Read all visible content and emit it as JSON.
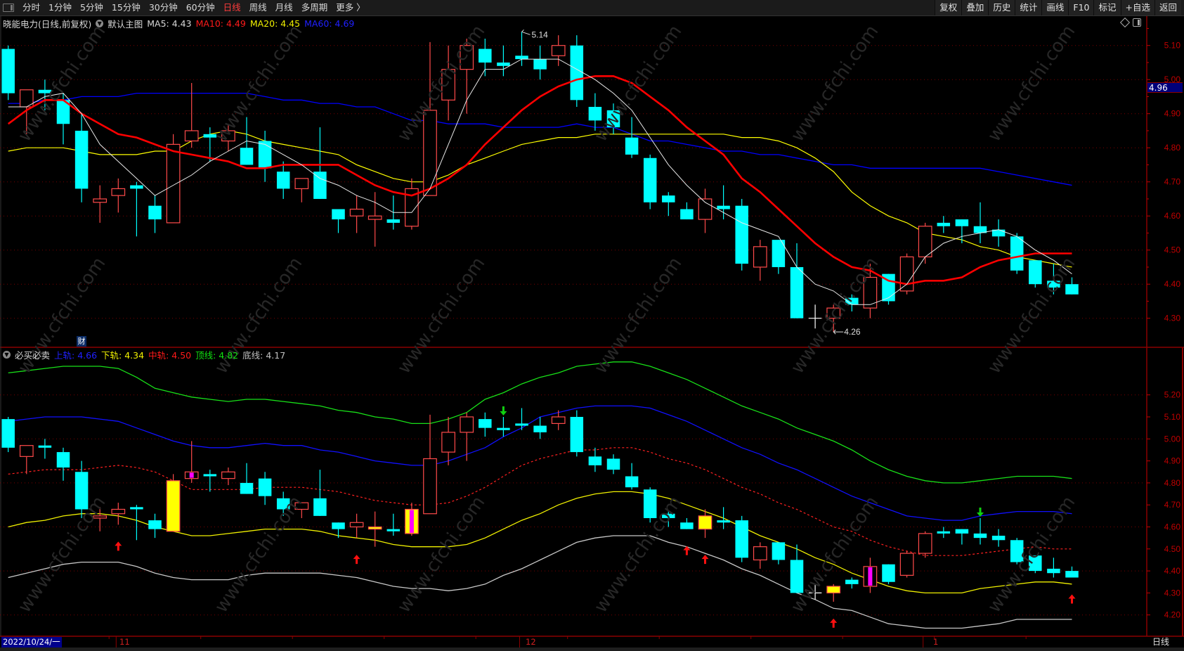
{
  "toolbar": {
    "periods": [
      "分时",
      "1分钟",
      "5分钟",
      "15分钟",
      "30分钟",
      "60分钟",
      "日线",
      "周线",
      "月线",
      "多周期",
      "更多 〉"
    ],
    "active_period": "日线",
    "buttons": [
      "复权",
      "叠加",
      "历史",
      "统计",
      "画线",
      "F10",
      "标记",
      "+自选",
      "返回"
    ]
  },
  "main_legend": {
    "stock": "晓能电力(日线,前复权)",
    "template": "默认主图",
    "ma5": "MA5: 4.43",
    "ma10": "MA10: 4.49",
    "ma20": "MA20: 4.45",
    "ma60": "MA60: 4.69"
  },
  "sub_legend": {
    "name": "必买必卖",
    "upper": "上轨: 4.66",
    "lower": "下轨: 4.34",
    "middle": "中轨: 4.50",
    "top": "顶线: 4.82",
    "bottom": "底线: 4.17"
  },
  "current_price": "4.96",
  "finance_marker": "财",
  "annotations": {
    "high": "5.14",
    "low": "4.26"
  },
  "time_axis": {
    "cursor_date": "2022/10/24/一",
    "months": [
      "11",
      "12",
      "1"
    ],
    "period_label": "日线"
  },
  "watermark": "www.cfchi.com",
  "colors": {
    "up": "#ff4a4a",
    "down": "#00ffff",
    "ma5": "#e8e8e8",
    "ma10": "#ff0000",
    "ma20": "#ffff00",
    "ma60": "#0000ff",
    "grid": "#7a0000",
    "axis": "#c00000"
  },
  "chart_data": {
    "type": "candlestick",
    "ohlc": [
      [
        5.09,
        5.1,
        4.94,
        4.96
      ],
      [
        4.92,
        4.97,
        4.84,
        4.97
      ],
      [
        4.97,
        5.0,
        4.91,
        4.96
      ],
      [
        4.94,
        4.96,
        4.81,
        4.87
      ],
      [
        4.85,
        4.9,
        4.64,
        4.68
      ],
      [
        4.64,
        4.69,
        4.58,
        4.65
      ],
      [
        4.66,
        4.71,
        4.61,
        4.68
      ],
      [
        4.69,
        4.7,
        4.54,
        4.68
      ],
      [
        4.63,
        4.66,
        4.55,
        4.59
      ],
      [
        4.58,
        4.84,
        4.58,
        4.81
      ],
      [
        4.82,
        4.99,
        4.8,
        4.85
      ],
      [
        4.84,
        4.86,
        4.76,
        4.83
      ],
      [
        4.82,
        4.87,
        4.79,
        4.85
      ],
      [
        4.8,
        4.89,
        4.75,
        4.75
      ],
      [
        4.82,
        4.85,
        4.7,
        4.74
      ],
      [
        4.73,
        4.76,
        4.65,
        4.68
      ],
      [
        4.68,
        4.71,
        4.64,
        4.71
      ],
      [
        4.73,
        4.86,
        4.65,
        4.65
      ],
      [
        4.62,
        4.62,
        4.55,
        4.59
      ],
      [
        4.6,
        4.66,
        4.55,
        4.62
      ],
      [
        4.59,
        4.67,
        4.51,
        4.6
      ],
      [
        4.59,
        4.66,
        4.56,
        4.58
      ],
      [
        4.57,
        4.71,
        4.56,
        4.68
      ],
      [
        4.66,
        5.11,
        4.66,
        4.91
      ],
      [
        4.94,
        5.1,
        4.88,
        5.03
      ],
      [
        5.03,
        5.12,
        4.9,
        5.1
      ],
      [
        5.09,
        5.12,
        5.01,
        5.05
      ],
      [
        5.05,
        5.1,
        5.01,
        5.04
      ],
      [
        5.07,
        5.14,
        5.04,
        5.06
      ],
      [
        5.06,
        5.1,
        5.0,
        5.03
      ],
      [
        5.07,
        5.13,
        5.04,
        5.1
      ],
      [
        5.1,
        5.13,
        4.92,
        4.94
      ],
      [
        4.92,
        4.96,
        4.85,
        4.88
      ],
      [
        4.91,
        4.93,
        4.84,
        4.86
      ],
      [
        4.83,
        4.89,
        4.77,
        4.78
      ],
      [
        4.77,
        4.78,
        4.62,
        4.64
      ],
      [
        4.66,
        4.67,
        4.6,
        4.64
      ],
      [
        4.62,
        4.64,
        4.59,
        4.59
      ],
      [
        4.59,
        4.68,
        4.55,
        4.65
      ],
      [
        4.63,
        4.69,
        4.59,
        4.62
      ],
      [
        4.63,
        4.65,
        4.44,
        4.46
      ],
      [
        4.45,
        4.53,
        4.41,
        4.51
      ],
      [
        4.53,
        4.53,
        4.43,
        4.45
      ],
      [
        4.45,
        4.52,
        4.3,
        4.3
      ],
      [
        4.3,
        4.34,
        4.27,
        4.3
      ],
      [
        4.3,
        4.34,
        4.26,
        4.33
      ],
      [
        4.36,
        4.37,
        4.32,
        4.34
      ],
      [
        4.33,
        4.46,
        4.3,
        4.42
      ],
      [
        4.43,
        4.43,
        4.34,
        4.35
      ],
      [
        4.38,
        4.49,
        4.37,
        4.48
      ],
      [
        4.48,
        4.58,
        4.46,
        4.57
      ],
      [
        4.58,
        4.6,
        4.55,
        4.57
      ],
      [
        4.59,
        4.59,
        4.52,
        4.57
      ],
      [
        4.57,
        4.64,
        4.52,
        4.55
      ],
      [
        4.56,
        4.59,
        4.51,
        4.54
      ],
      [
        4.54,
        4.55,
        4.43,
        4.44
      ],
      [
        4.47,
        4.47,
        4.39,
        4.4
      ],
      [
        4.41,
        4.46,
        4.37,
        4.39
      ],
      [
        4.4,
        4.42,
        4.37,
        4.37
      ]
    ],
    "ma5": [
      4.92,
      4.92,
      4.95,
      4.96,
      4.9,
      4.81,
      4.76,
      4.71,
      4.66,
      4.69,
      4.72,
      4.76,
      4.79,
      4.82,
      4.81,
      4.78,
      4.75,
      4.71,
      4.69,
      4.66,
      4.64,
      4.61,
      4.61,
      4.68,
      4.81,
      4.94,
      5.03,
      5.03,
      5.06,
      5.06,
      5.06,
      5.03,
      5.0,
      4.96,
      4.91,
      4.83,
      4.75,
      4.69,
      4.64,
      4.61,
      4.58,
      4.56,
      4.54,
      4.45,
      4.4,
      4.38,
      4.34,
      4.34,
      4.36,
      4.4,
      4.48,
      4.52,
      4.54,
      4.55,
      4.56,
      4.54,
      4.5,
      4.47,
      4.43
    ],
    "ma10": [
      4.87,
      4.91,
      4.94,
      4.94,
      4.9,
      4.87,
      4.84,
      4.83,
      4.81,
      4.79,
      4.78,
      4.77,
      4.76,
      4.74,
      4.74,
      4.75,
      4.75,
      4.75,
      4.75,
      4.72,
      4.69,
      4.67,
      4.66,
      4.68,
      4.71,
      4.75,
      4.81,
      4.86,
      4.91,
      4.95,
      4.98,
      5.0,
      5.01,
      5.01,
      4.99,
      4.95,
      4.91,
      4.86,
      4.82,
      4.78,
      4.71,
      4.67,
      4.62,
      4.57,
      4.52,
      4.48,
      4.45,
      4.44,
      4.41,
      4.4,
      4.41,
      4.41,
      4.42,
      4.45,
      4.47,
      4.48,
      4.49,
      4.49,
      4.49
    ],
    "ma20": [
      4.79,
      4.8,
      4.8,
      4.8,
      4.79,
      4.78,
      4.78,
      4.78,
      4.79,
      4.79,
      4.82,
      4.84,
      4.85,
      4.84,
      4.82,
      4.81,
      4.8,
      4.79,
      4.78,
      4.75,
      4.73,
      4.71,
      4.7,
      4.7,
      4.72,
      4.75,
      4.77,
      4.79,
      4.81,
      4.82,
      4.83,
      4.83,
      4.84,
      4.84,
      4.84,
      4.84,
      4.84,
      4.84,
      4.84,
      4.84,
      4.83,
      4.83,
      4.82,
      4.8,
      4.77,
      4.73,
      4.67,
      4.63,
      4.6,
      4.58,
      4.55,
      4.54,
      4.53,
      4.51,
      4.5,
      4.48,
      4.47,
      4.46,
      4.45
    ],
    "ma60": [
      4.93,
      4.93,
      4.94,
      4.94,
      4.95,
      4.95,
      4.95,
      4.96,
      4.96,
      4.96,
      4.96,
      4.96,
      4.96,
      4.96,
      4.95,
      4.94,
      4.94,
      4.93,
      4.93,
      4.92,
      4.92,
      4.9,
      4.88,
      4.88,
      4.87,
      4.87,
      4.87,
      4.86,
      4.86,
      4.86,
      4.86,
      4.87,
      4.86,
      4.86,
      4.84,
      4.82,
      4.82,
      4.81,
      4.8,
      4.79,
      4.79,
      4.78,
      4.78,
      4.77,
      4.76,
      4.75,
      4.75,
      4.74,
      4.74,
      4.74,
      4.74,
      4.74,
      4.74,
      4.74,
      4.73,
      4.72,
      4.71,
      4.7,
      4.69
    ],
    "band_top": [
      5.3,
      5.31,
      5.32,
      5.33,
      5.33,
      5.33,
      5.32,
      5.28,
      5.23,
      5.21,
      5.19,
      5.18,
      5.17,
      5.18,
      5.18,
      5.17,
      5.16,
      5.15,
      5.13,
      5.12,
      5.1,
      5.09,
      5.07,
      5.07,
      5.09,
      5.12,
      5.18,
      5.21,
      5.25,
      5.28,
      5.3,
      5.33,
      5.34,
      5.35,
      5.35,
      5.33,
      5.3,
      5.27,
      5.23,
      5.19,
      5.15,
      5.12,
      5.09,
      5.05,
      5.02,
      4.99,
      4.95,
      4.9,
      4.86,
      4.83,
      4.81,
      4.8,
      4.8,
      4.81,
      4.82,
      4.83,
      4.83,
      4.83,
      4.82
    ],
    "band_upper": [
      5.08,
      5.09,
      5.1,
      5.1,
      5.1,
      5.09,
      5.08,
      5.05,
      5.02,
      4.99,
      4.97,
      4.96,
      4.96,
      4.97,
      4.98,
      4.97,
      4.97,
      4.95,
      4.94,
      4.92,
      4.9,
      4.89,
      4.88,
      4.88,
      4.9,
      4.93,
      4.96,
      5.01,
      5.05,
      5.1,
      5.12,
      5.14,
      5.15,
      5.15,
      5.15,
      5.14,
      5.11,
      5.08,
      5.04,
      5.0,
      4.96,
      4.93,
      4.89,
      4.86,
      4.82,
      4.78,
      4.74,
      4.71,
      4.68,
      4.65,
      4.64,
      4.63,
      4.63,
      4.65,
      4.66,
      4.67,
      4.67,
      4.67,
      4.66
    ],
    "band_middle": [
      4.84,
      4.85,
      4.86,
      4.86,
      4.86,
      4.87,
      4.88,
      4.87,
      4.85,
      4.81,
      4.77,
      4.77,
      4.77,
      4.77,
      4.78,
      4.78,
      4.78,
      4.77,
      4.76,
      4.74,
      4.72,
      4.71,
      4.7,
      4.7,
      4.71,
      4.74,
      4.78,
      4.83,
      4.88,
      4.91,
      4.93,
      4.95,
      4.95,
      4.96,
      4.96,
      4.94,
      4.91,
      4.89,
      4.86,
      4.82,
      4.78,
      4.75,
      4.71,
      4.68,
      4.64,
      4.6,
      4.58,
      4.54,
      4.51,
      4.49,
      4.47,
      4.47,
      4.47,
      4.48,
      4.49,
      4.5,
      4.51,
      4.5,
      4.5
    ],
    "band_lower": [
      4.6,
      4.62,
      4.63,
      4.65,
      4.66,
      4.66,
      4.65,
      4.63,
      4.6,
      4.58,
      4.56,
      4.56,
      4.57,
      4.58,
      4.59,
      4.59,
      4.59,
      4.58,
      4.56,
      4.55,
      4.54,
      4.52,
      4.51,
      4.51,
      4.51,
      4.52,
      4.55,
      4.59,
      4.63,
      4.66,
      4.7,
      4.73,
      4.75,
      4.76,
      4.76,
      4.75,
      4.73,
      4.7,
      4.67,
      4.64,
      4.6,
      4.56,
      4.53,
      4.5,
      4.46,
      4.43,
      4.39,
      4.36,
      4.33,
      4.31,
      4.3,
      4.3,
      4.3,
      4.32,
      4.33,
      4.34,
      4.35,
      4.35,
      4.34
    ],
    "band_bottom": [
      4.37,
      4.39,
      4.41,
      4.43,
      4.44,
      4.44,
      4.44,
      4.42,
      4.39,
      4.37,
      4.36,
      4.36,
      4.36,
      4.38,
      4.39,
      4.39,
      4.39,
      4.39,
      4.38,
      4.37,
      4.35,
      4.33,
      4.32,
      4.32,
      4.31,
      4.32,
      4.34,
      4.38,
      4.41,
      4.45,
      4.49,
      4.53,
      4.55,
      4.56,
      4.56,
      4.56,
      4.53,
      4.51,
      4.48,
      4.45,
      4.41,
      4.38,
      4.34,
      4.3,
      4.27,
      4.23,
      4.22,
      4.19,
      4.16,
      4.15,
      4.14,
      4.14,
      4.14,
      4.15,
      4.16,
      4.18,
      4.18,
      4.18,
      4.18
    ],
    "highlight_candles": {
      "9": "yellow",
      "10": "magenta",
      "20": "yellow",
      "22": "both",
      "38": "yellow",
      "45": "yellow",
      "47": "magenta"
    },
    "buy_signals": [
      6,
      19,
      37,
      38,
      45,
      58
    ],
    "sell_signals": [
      27,
      53
    ],
    "high_index": 28,
    "low_index": 45,
    "month_start_index": [
      6,
      28,
      50
    ],
    "main_y_ticks": [
      "5.10",
      "5.00",
      "4.90",
      "4.80",
      "4.70",
      "4.60",
      "4.50",
      "4.40",
      "4.30"
    ],
    "main_ylim": [
      4.25,
      5.16
    ],
    "sub_y_ticks": [
      "5.20",
      "5.10",
      "5.00",
      "4.90",
      "4.80",
      "4.70",
      "4.60",
      "4.50",
      "4.40",
      "4.30",
      "4.20"
    ],
    "sub_ylim": [
      4.12,
      5.38
    ]
  }
}
